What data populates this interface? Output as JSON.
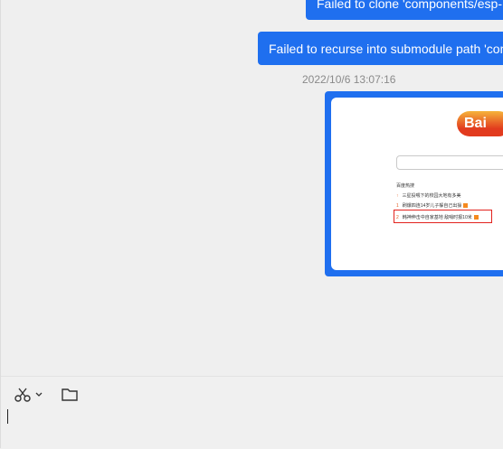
{
  "messages": [
    {
      "type": "text",
      "text": "Failed to clone 'components/esp-"
    },
    {
      "type": "text",
      "text": "Failed to recurse into submodule path 'com"
    }
  ],
  "timestamp": "2022/10/6 13:07:16",
  "image_message": {
    "logo_text": "Bai",
    "hot_title": "百度热搜",
    "hot_items": [
      {
        "rank": "↑",
        "text": "三星投喂下的校园大地有多美"
      },
      {
        "rank": "1",
        "text": "刷爆四连14岁儿子躲自己出操"
      },
      {
        "rank": "2",
        "text": "韩神伸击中自家基地 敌哨时报10米"
      }
    ]
  },
  "toolbar": {
    "cut_icon": "scissors-icon",
    "dropdown_icon": "chevron-down-icon",
    "folder_icon": "folder-icon"
  },
  "colors": {
    "bubble": "#1f6fef",
    "highlight": "#e2231e",
    "background": "#efefef"
  }
}
